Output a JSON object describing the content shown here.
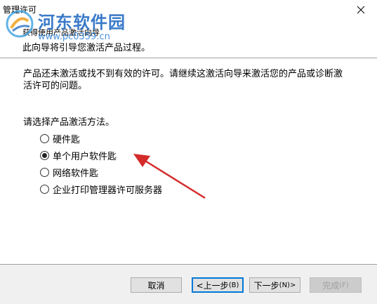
{
  "window": {
    "title": "管理许可"
  },
  "watermark": {
    "brand": "河东软件园",
    "url": "www.pc0359.cn"
  },
  "header": {
    "title": "获得使用产品激活向导",
    "subtitle": "此向导将引导您激活产品过程。"
  },
  "main": {
    "description": "产品还未激活或找不到有效的许可。请继续这激活向导来激活您的产品或诊断激活许可的问题。",
    "prompt": "请选择产品激活方法。",
    "options": [
      {
        "label": "硬件匙",
        "checked": false
      },
      {
        "label": "单个用户软件匙",
        "checked": true
      },
      {
        "label": "网络软件匙",
        "checked": false
      },
      {
        "label": "企业打印管理器许可服务器",
        "checked": false
      }
    ]
  },
  "footer": {
    "cancel": "取消",
    "back": "<上一步",
    "back_mn": "(B)",
    "next": "下一步",
    "next_mn": "(N)>",
    "finish": "完成",
    "finish_mn": "(F)"
  },
  "colors": {
    "arrow": "#d42a2a",
    "watermark": "#2a6fc4",
    "focus": "#0078d7"
  },
  "icons": [
    "close-icon",
    "logo-icon",
    "annotation-arrow"
  ]
}
